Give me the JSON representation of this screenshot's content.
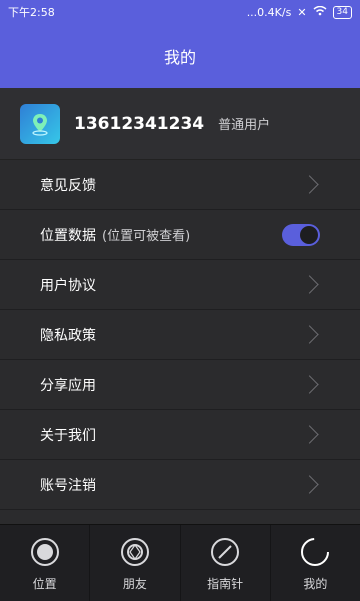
{
  "statusbar": {
    "time": "下午2:58",
    "network": "...0.4K/s",
    "battery": "34"
  },
  "header": {
    "title": "我的"
  },
  "profile": {
    "phone": "13612341234",
    "role": "普通用户"
  },
  "menu": {
    "items": [
      {
        "label": "意见反馈"
      },
      {
        "label": "位置数据",
        "sub": "(位置可被查看)",
        "toggle_on": true
      },
      {
        "label": "用户协议"
      },
      {
        "label": "隐私政策"
      },
      {
        "label": "分享应用"
      },
      {
        "label": "关于我们"
      },
      {
        "label": "账号注销"
      }
    ]
  },
  "tabbar": {
    "tabs": [
      {
        "label": "位置",
        "icon": "record-icon"
      },
      {
        "label": "朋友",
        "icon": "aperture-icon"
      },
      {
        "label": "指南针",
        "icon": "compass-icon"
      },
      {
        "label": "我的",
        "icon": "profile-ring-icon"
      }
    ]
  },
  "colors": {
    "accent": "#5a5fdc",
    "background": "#2b2b2d"
  }
}
